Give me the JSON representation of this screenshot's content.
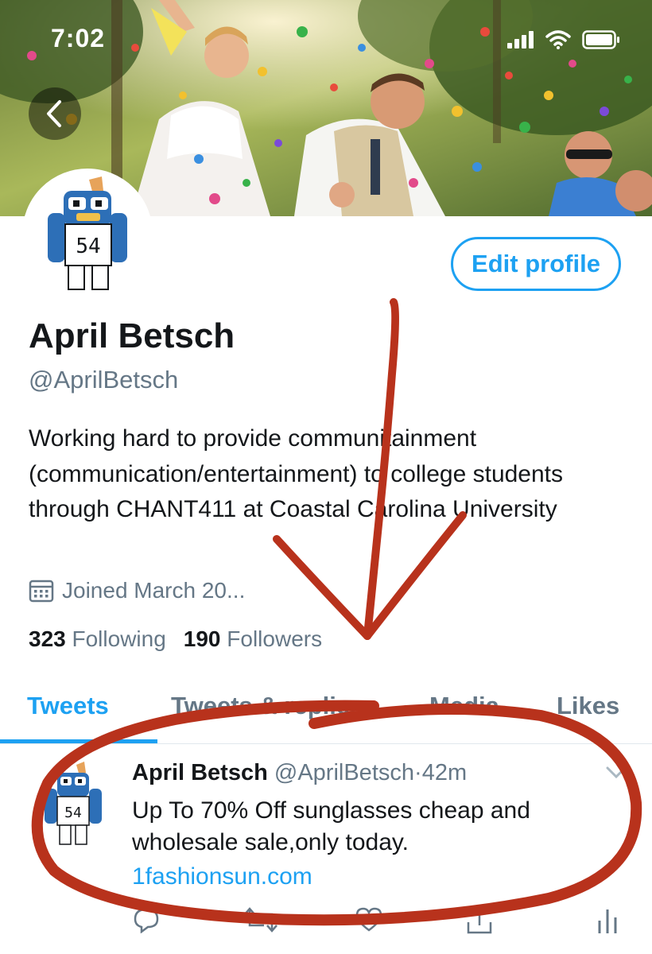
{
  "status_bar": {
    "time": "7:02"
  },
  "profile": {
    "name": "April Betsch",
    "handle": "@AprilBetsch",
    "edit_button": "Edit profile",
    "bio": "Working hard to provide communitainment (communication/entertainment) to college students through CHANT411 at Coastal Carolina University",
    "joined": "Joined March 20...",
    "following_count": "323",
    "following_label": "Following",
    "followers_count": "190",
    "followers_label": "Followers",
    "avatar_jersey": "54"
  },
  "tabs": [
    {
      "label": "Tweets",
      "active": true
    },
    {
      "label": "Tweets & replies",
      "active": false
    },
    {
      "label": "Media",
      "active": false
    },
    {
      "label": "Likes",
      "active": false
    }
  ],
  "tweet": {
    "author": "April Betsch",
    "handle": "@AprilBetsch",
    "separator": "·",
    "time": "42m",
    "text": "Up To 70% Off sunglasses cheap and wholesale sale,only today.",
    "link": "1fashionsun.com"
  },
  "icons": {
    "back": "chevron-left-icon",
    "calendar": "calendar-icon",
    "reply": "reply-icon",
    "retweet": "retweet-icon",
    "like": "heart-icon",
    "share": "share-icon",
    "analytics": "analytics-icon"
  },
  "colors": {
    "accent": "#1da1f2",
    "secondary_text": "#657786",
    "annotation_red": "#b8321c"
  }
}
